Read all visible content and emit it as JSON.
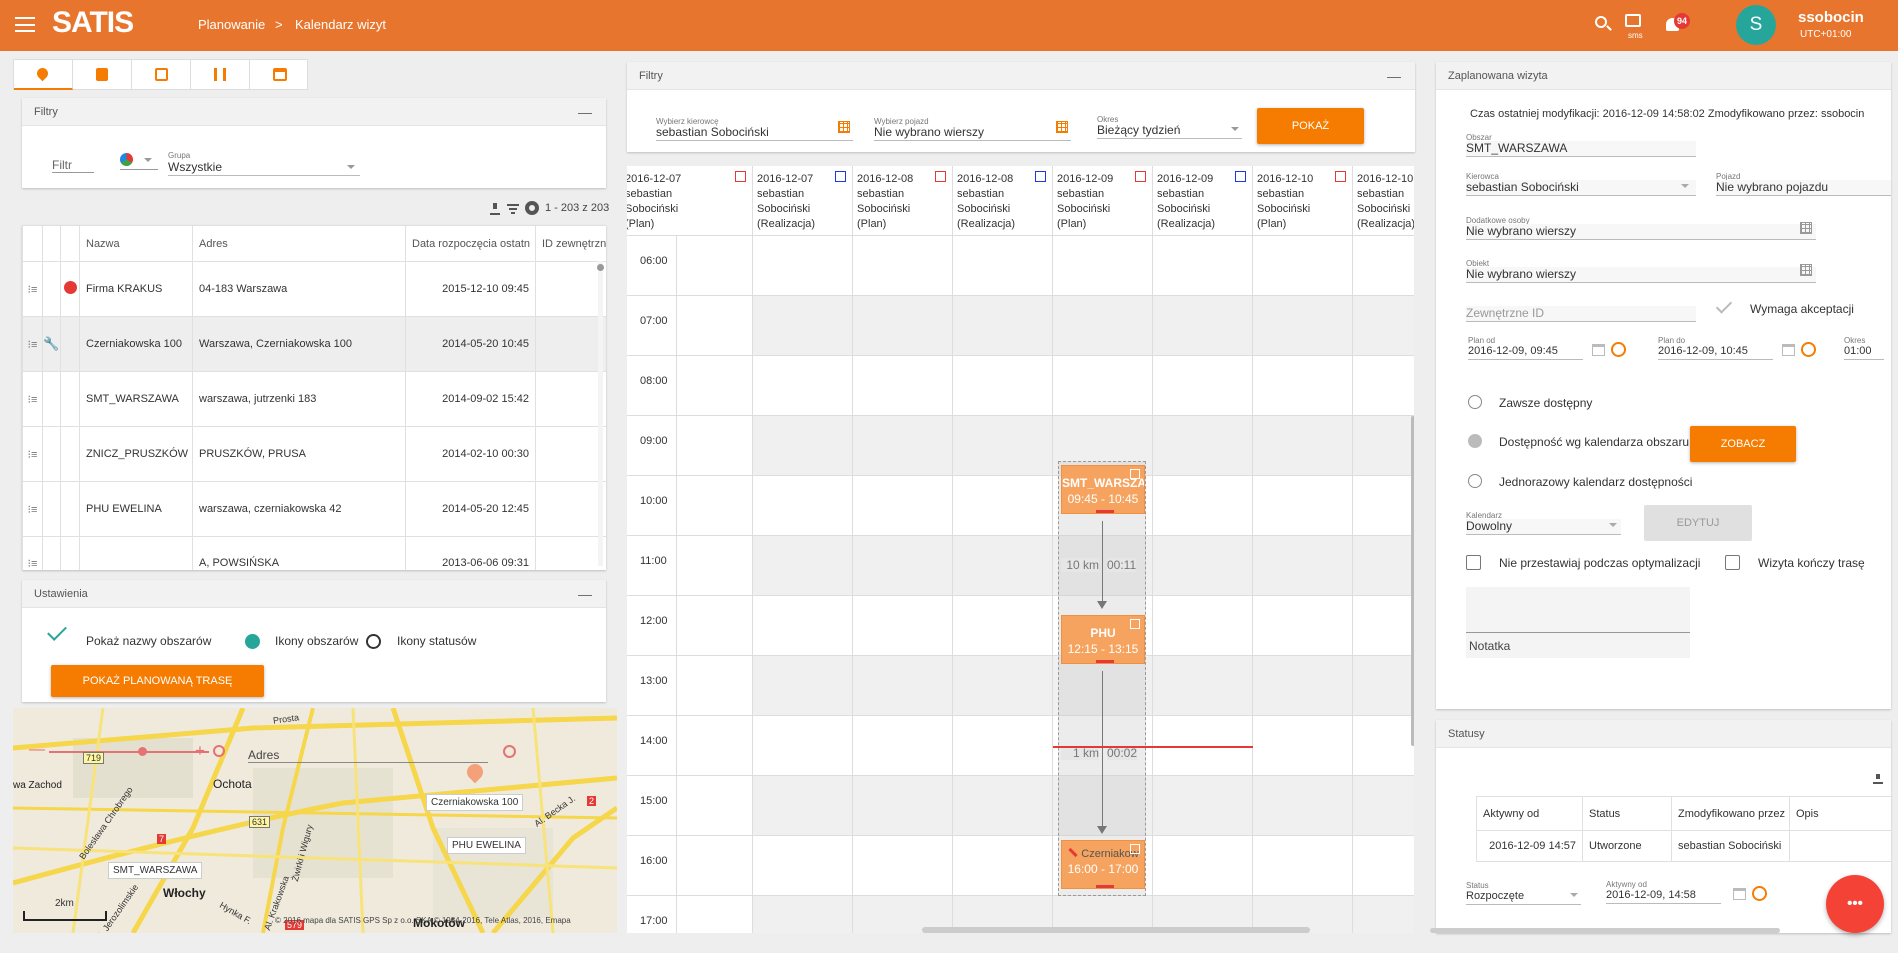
{
  "header": {
    "logo": "SATIS",
    "breadcrumb_1": "Planowanie",
    "breadcrumb_sep": ">",
    "breadcrumb_2": "Kalendarz wizyt",
    "sms_label": "sms",
    "notif_count": "94",
    "avatar_letter": "S",
    "username": "ssobocin",
    "timezone": "UTC+01:00",
    "accent": "#e8752d"
  },
  "left": {
    "filters_title": "Filtry",
    "filter_label": "Filtr",
    "group_label": "Grupa",
    "group_value": "Wszystkie",
    "pagination": "1 - 203 z 203",
    "columns": [
      "Nazwa",
      "Adres",
      "Data rozpoczęcia ostatn",
      "ID zewnętrzne"
    ],
    "rows": [
      {
        "name": "Firma KRAKUS",
        "address": "04-183 Warszawa",
        "date": "2015-12-10 09:45"
      },
      {
        "name": "Czerniakowska 100",
        "address": "Warszawa, Czerniakowska 100",
        "date": "2014-05-20 10:45"
      },
      {
        "name": "SMT_WARSZAWA",
        "address": "warszawa, jutrzenki 183",
        "date": "2014-09-02 15:42"
      },
      {
        "name": "ZNICZ_PRUSZKÓW",
        "address": "PRUSZKÓW, PRUSA",
        "date": "2014-02-10 00:30"
      },
      {
        "name": "PHU EWELINA",
        "address": "warszawa, czerniakowska 42",
        "date": "2014-05-20 12:45"
      },
      {
        "name": "",
        "address": "A, POWSIŃSKA",
        "date": "2013-06-06 09:31"
      }
    ],
    "settings_title": "Ustawienia",
    "show_area_names": "Pokaż nazwy obszarów",
    "area_icons": "Ikony obszarów",
    "status_icons": "Ikony statusów",
    "show_route_btn": "POKAŻ PLANOWANĄ TRASĘ",
    "map": {
      "search_label": "Adres",
      "scale": "2km",
      "copyright": "© 2016 mapa dla SATIS GPS Sp z o.o. SKA © 1984-2016, Tele Atlas, 2016, Emapa",
      "labels": [
        "Ochota",
        "Włochy",
        "Mokotów",
        "Czerniakowska 100",
        "PHU EWELINA",
        "SMT_WARSZAWA",
        "wa Zachod",
        "Al. Jerozolimskie",
        "Al. Krakowska",
        "Al. Becka J.",
        "Bolesława Chrobrego",
        "Żwirki i Wigury",
        "Prosta",
        "Hynka F.",
        "631",
        "719",
        "579",
        "2",
        "7"
      ]
    }
  },
  "center": {
    "filters_title": "Filtry",
    "driver_label": "Wybierz kierowcę",
    "driver_value": "sebastian Sobociński",
    "vehicle_label": "Wybierz pojazd",
    "vehicle_value": "Nie wybrano wierszy",
    "period_label": "Okres",
    "period_value": "Bieżący tydzień",
    "show_btn": "POKAŻ",
    "days": [
      {
        "date": "2016-12-07",
        "who": "sebastian Sobociński",
        "type": "(Plan)",
        "flag": "red"
      },
      {
        "date": "2016-12-07",
        "who": "sebastian Sobociński",
        "type": "(Realizacja)",
        "flag": "blue"
      },
      {
        "date": "2016-12-08",
        "who": "sebastian Sobociński",
        "type": "(Plan)",
        "flag": "red"
      },
      {
        "date": "2016-12-08",
        "who": "sebastian Sobociński",
        "type": "(Realizacja)",
        "flag": "blue"
      },
      {
        "date": "2016-12-09",
        "who": "sebastian Sobociński",
        "type": "(Plan)",
        "flag": "red"
      },
      {
        "date": "2016-12-09",
        "who": "sebastian Sobociński",
        "type": "(Realizacja)",
        "flag": "blue"
      },
      {
        "date": "2016-12-10",
        "who": "sebastian Sobociński",
        "type": "(Plan)",
        "flag": "red"
      },
      {
        "date": "2016-12-10",
        "who": "sebastian Sobociński",
        "type": "(Realizacja)",
        "flag": "blue"
      }
    ],
    "hours": [
      "06:00",
      "07:00",
      "08:00",
      "09:00",
      "10:00",
      "11:00",
      "12:00",
      "13:00",
      "14:00",
      "15:00",
      "16:00",
      "17:00"
    ],
    "visits": [
      {
        "title": "SMT_WARSZA",
        "time": "09:45 - 10:45",
        "start_h": 9.75,
        "end_h": 10.75
      },
      {
        "title": "PHU",
        "time": "12:15 - 13:15",
        "start_h": 12.25,
        "end_h": 13.25
      },
      {
        "title": "Czerniakow",
        "time": "16:00 - 17:00",
        "start_h": 16.0,
        "end_h": 17.0
      }
    ],
    "travels": [
      {
        "dist": "10 km",
        "dur": "00:11"
      },
      {
        "dist": "1 km",
        "dur": "00:02"
      }
    ],
    "now_h": 14.5
  },
  "right": {
    "visit_title": "Zaplanowana wizyta",
    "modified_text": "Czas ostatniej modyfikacji: 2016-12-09 14:58:02 Zmodyfikowano przez: ssobocin",
    "area_label": "Obszar",
    "area_value": "SMT_WARSZAWA",
    "driver_label": "Kierowca",
    "driver_value": "sebastian Sobociński",
    "vehicle_label": "Pojazd",
    "vehicle_value": "Nie wybrano pojazdu",
    "extra_label": "Dodatkowe osoby",
    "extra_value": "Nie wybrano wierszy",
    "object_label": "Obiekt",
    "object_value": "Nie wybrano wierszy",
    "ext_id_placeholder": "Zewnętrzne ID",
    "requires_accept": "Wymaga akceptacji",
    "plan_from_label": "Plan od",
    "plan_from_value": "2016-12-09, 09:45",
    "plan_to_label": "Plan do",
    "plan_to_value": "2016-12-09, 10:45",
    "period_label": "Okres",
    "period_value": "01:00",
    "always_available": "Zawsze dostępny",
    "avail_by_calendar": "Dostępność wg kalendarza obszaru",
    "see_btn": "ZOBACZ",
    "one_time": "Jednorazowy kalendarz dostępności",
    "calendar_label": "Kalendarz",
    "calendar_value": "Dowolny",
    "edit_btn": "EDYTUJ",
    "no_move": "Nie przestawiaj podczas optymalizacji",
    "ends_route": "Wizyta kończy trasę",
    "note_label": "Notatka",
    "statuses_title": "Statusy",
    "status_columns": [
      "Aktywny od",
      "Status",
      "Zmodyfikowano przez",
      "Opis"
    ],
    "status_rows": [
      {
        "from": "2016-12-09 14:57",
        "status": "Utworzone",
        "by": "sebastian Sobociński",
        "desc": ""
      }
    ],
    "status_label": "Status",
    "status_value": "Rozpoczęte",
    "active_label": "Aktywny od",
    "active_value": "2016-12-09, 14:58",
    "fab": "•••"
  }
}
